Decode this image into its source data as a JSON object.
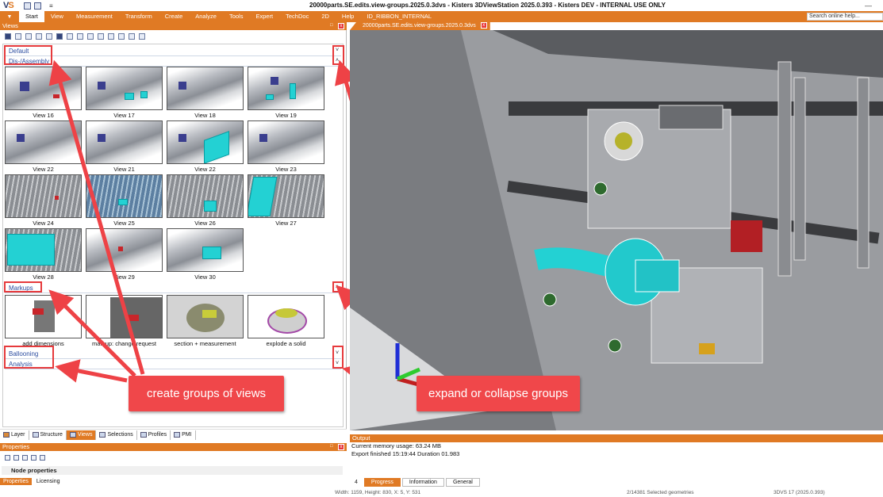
{
  "window": {
    "title": "20000parts.SE.edits.view-groups.2025.0.3dvs - Kisters 3DViewStation 2025.0.393 - Kisters DEV - INTERNAL USE ONLY",
    "logo": "VS",
    "minimize": "—"
  },
  "ribbon": {
    "app_menu": "▼",
    "tabs": [
      "Start",
      "View",
      "Measurement",
      "Transform",
      "Create",
      "Analyze",
      "Tools",
      "Expert",
      "TechDoc",
      "2D",
      "Help",
      "ID_RIBBON_INTERNAL"
    ],
    "active_tab": "Start",
    "search_placeholder": "Search online help..."
  },
  "views_panel": {
    "title": "Views",
    "pin": "⌂",
    "close": "x",
    "groups": [
      {
        "label": "Default",
        "toggle": "˅"
      },
      {
        "label": "Dis-/Assembly",
        "toggle": "˄"
      },
      {
        "label": "Markups",
        "toggle": "˄"
      },
      {
        "label": "Ballooning",
        "toggle": "˅"
      },
      {
        "label": "Analysis",
        "toggle": "˅"
      }
    ],
    "assembly_views": [
      "View 16",
      "View 17",
      "View 18",
      "View 19",
      "View 22",
      "View 21",
      "View 22",
      "View 23",
      "View 24",
      "View 25",
      "View 26",
      "View 27",
      "View 28",
      "View 29",
      "View 30"
    ],
    "markup_views": [
      "add dimensions",
      "markup: change request",
      "section + measurement",
      "explode a solid"
    ]
  },
  "panel_tabs": [
    {
      "label": "Layer"
    },
    {
      "label": "Structure"
    },
    {
      "label": "Views",
      "active": true
    },
    {
      "label": "Selections"
    },
    {
      "label": "Profiles"
    },
    {
      "label": "PMI"
    }
  ],
  "properties_panel": {
    "title": "Properties",
    "node_properties": "Node properties",
    "tabs": [
      "Properties",
      "Licensing"
    ]
  },
  "document_tab": {
    "label": "20000parts.SE.edits.view-groups.2025.0.3dvs"
  },
  "output_panel": {
    "title": "Output",
    "lines": [
      "Current memory usage: 63.24 MB",
      "Export finished 15:19:44 Duration 01.983"
    ],
    "tabs": [
      "Progress",
      "Information",
      "General"
    ],
    "active_tab": "Progress",
    "nav": "4"
  },
  "status_bar": {
    "dimensions": "Width: 1159, Height: 830, X: 5, Y: 531",
    "selection": "2/14381 Selected geometries",
    "version": "3DVS 17 (2025.0.393)"
  },
  "annotations": {
    "left_callout": "create groups of views",
    "right_callout": "expand or collapse groups"
  },
  "colors": {
    "accent": "#e07a24",
    "callout": "#f0474a",
    "group_label": "#2d4ea0"
  }
}
